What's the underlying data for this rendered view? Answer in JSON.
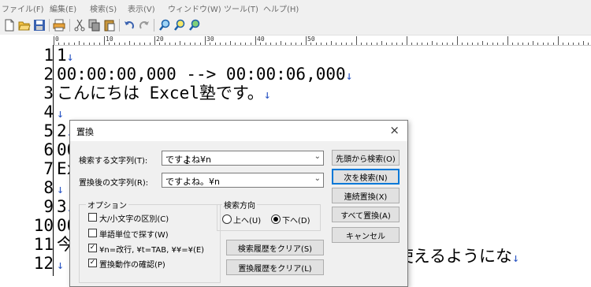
{
  "menu": [
    "ファイル(F)",
    "編集(E)",
    "検索(S)",
    "表示(V)",
    "ウィンドウ(W)",
    "ツール(T)",
    "ヘルプ(H)"
  ],
  "toolbar_icons": [
    "new-file-icon",
    "open-folder-icon",
    "save-icon",
    "print-icon",
    "cut-icon",
    "copy-icon",
    "paste-icon",
    "undo-icon",
    "redo-icon",
    "find-icon",
    "find-next-icon",
    "find-prev-icon"
  ],
  "ruler": {
    "labels": [
      "0",
      "10",
      "20",
      "30",
      "40",
      "50"
    ]
  },
  "editor": {
    "line_numbers": [
      "1",
      "2",
      "3",
      "4",
      "5",
      "6",
      "7",
      "8",
      "9",
      "10",
      "11",
      "12"
    ],
    "lines": [
      "1",
      "00:00:00,000 --> 00:00:06,000",
      "こんにちは Excel塾です。",
      "",
      "2",
      "00",
      "Ex",
      "",
      "3",
      "00",
      "今",
      ""
    ],
    "line11_tail": "lで使えるようにな",
    "eol_mark": "↓"
  },
  "dialog": {
    "title": "置換",
    "close": "×",
    "find_label": "検索する文字列(T):",
    "find_value": "ですよね¥n",
    "replace_label": "置換後の文字列(R):",
    "replace_value": "ですよね。¥n",
    "options_title": "オプション",
    "options": [
      {
        "label": "大/小文字の区別(C)",
        "checked": false
      },
      {
        "label": "単語単位で探す(W)",
        "checked": false
      },
      {
        "label": "¥n=改行, ¥t=TAB, ¥¥=¥(E)",
        "checked": true
      },
      {
        "label": "置換動作の確認(P)",
        "checked": true
      }
    ],
    "direction_title": "検索方向",
    "dir_up": "上へ(U)",
    "dir_down": "下へ(D)",
    "dir_selected": "down",
    "clear_find_history": "検索履歴をクリア(S)",
    "clear_replace_history": "置換履歴をクリア(L)",
    "buttons": {
      "search_from_top": "先頭から検索(O)",
      "find_next": "次を検索(N)",
      "replace_continuous": "連続置換(X)",
      "replace_all": "すべて置換(A)",
      "cancel": "キャンセル"
    }
  }
}
